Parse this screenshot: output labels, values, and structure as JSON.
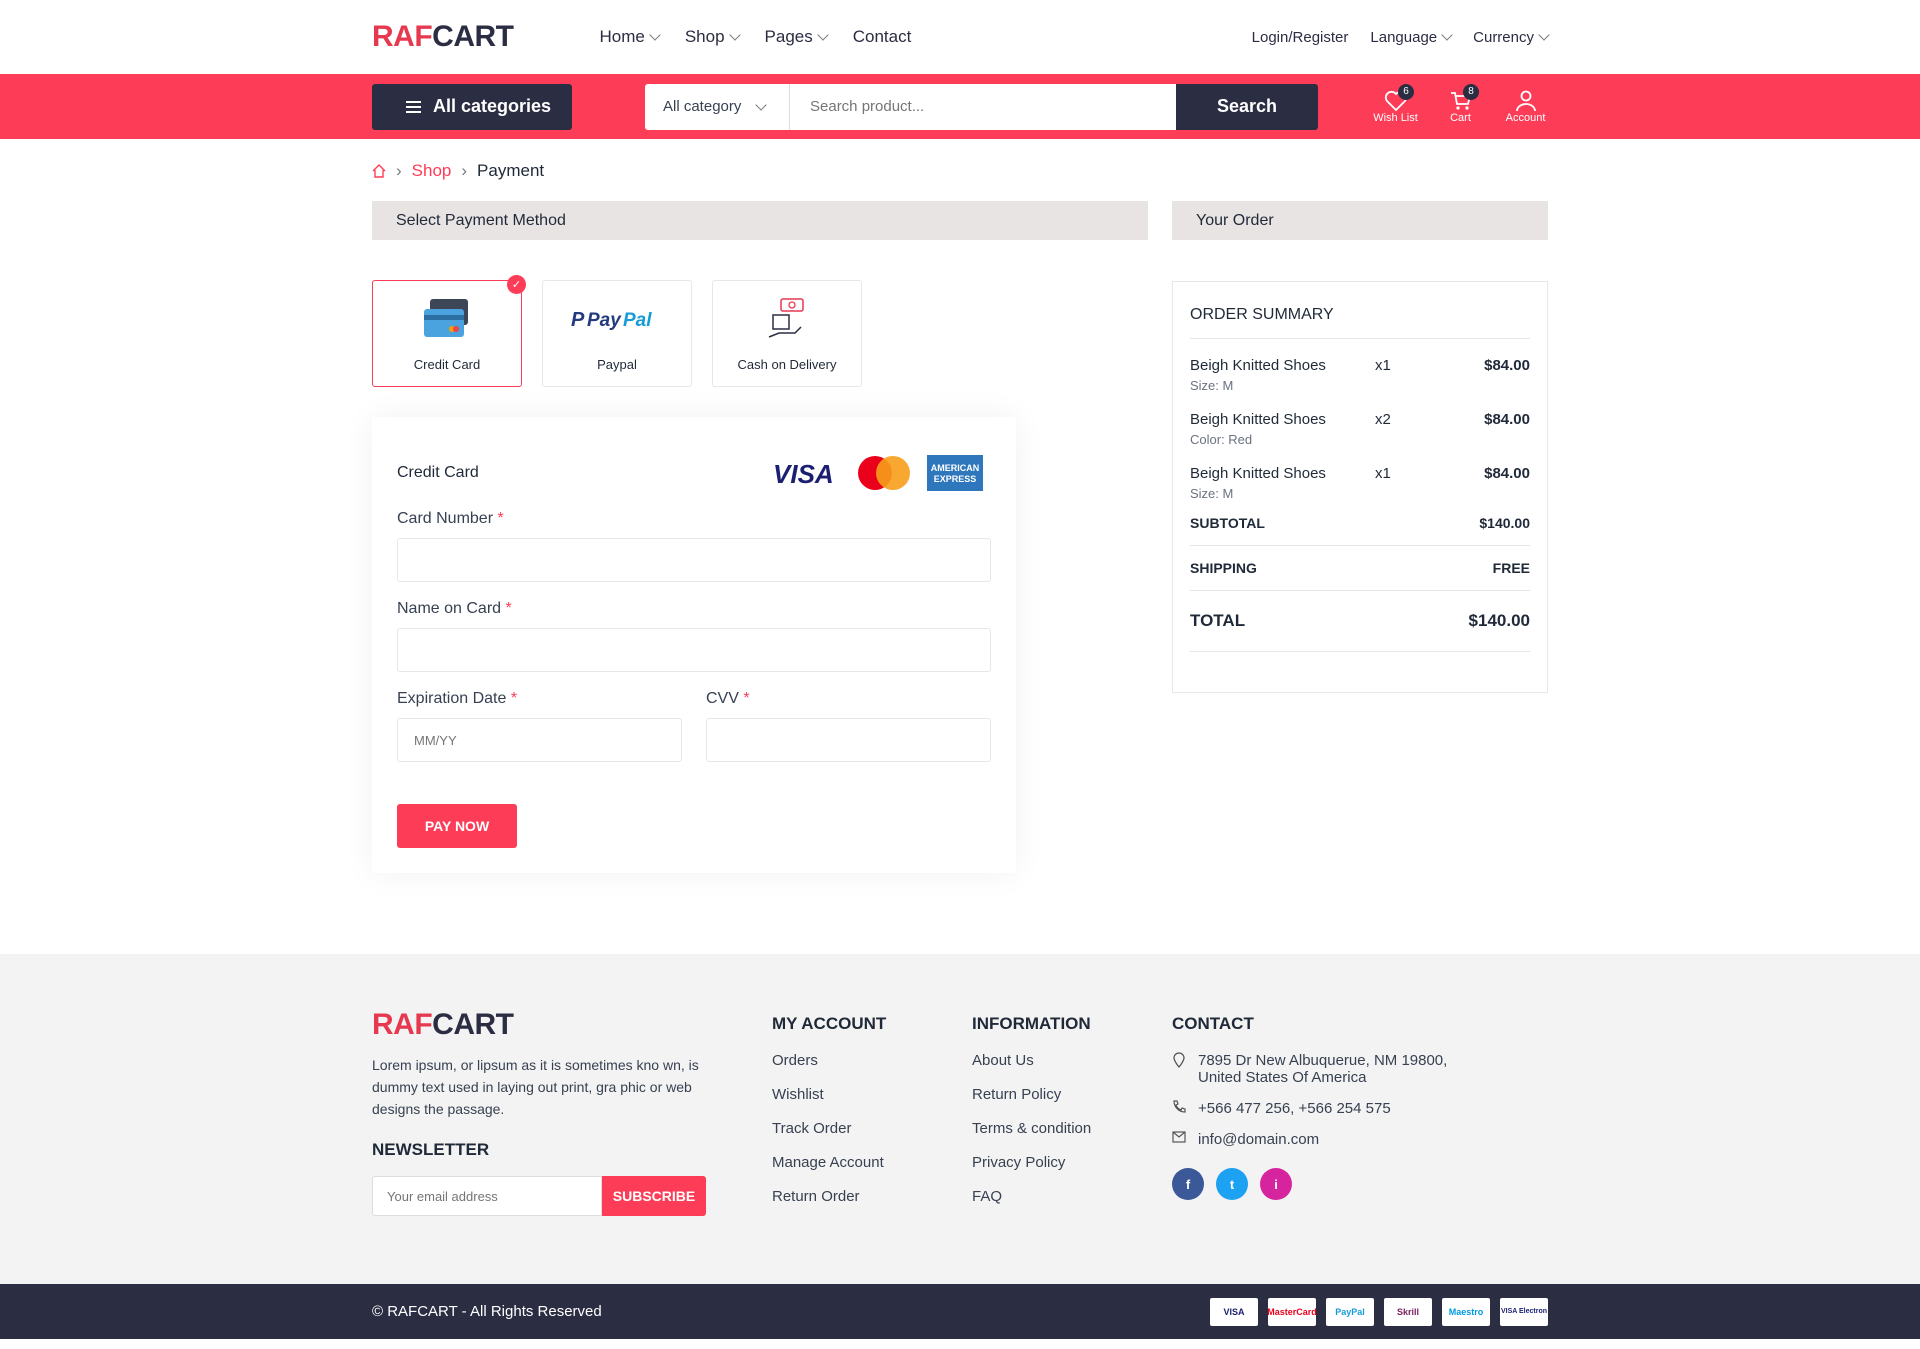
{
  "colors": {
    "accent": "#fd3d57",
    "dark": "#2b2d42",
    "panel": "#e9e4e4"
  },
  "header": {
    "logo_a": "RAF",
    "logo_b": "CART",
    "nav": [
      {
        "label": "Home",
        "has_dropdown": true
      },
      {
        "label": "Shop",
        "has_dropdown": true
      },
      {
        "label": "Pages",
        "has_dropdown": true
      },
      {
        "label": "Contact",
        "has_dropdown": false
      }
    ],
    "right": {
      "login": "Login/Register",
      "language": "Language",
      "currency": "Currency"
    }
  },
  "categorybar": {
    "all_categories": "All categories",
    "category_select": "All category",
    "search_placeholder": "Search product...",
    "search_button": "Search",
    "wishlist": {
      "label": "Wish List",
      "count": "6",
      "icon": "heart-icon"
    },
    "cart": {
      "label": "Cart",
      "count": "8",
      "icon": "cart-icon"
    },
    "account": {
      "label": "Account",
      "icon": "user-icon"
    }
  },
  "breadcrumb": {
    "home_icon": "home-icon",
    "shop": "Shop",
    "current": "Payment"
  },
  "payment": {
    "section_title": "Select Payment Method",
    "methods": [
      {
        "label": "Credit Card",
        "icon": "credit-card-icon",
        "selected": true
      },
      {
        "label": "Paypal",
        "icon": "paypal-icon",
        "selected": false
      },
      {
        "label": "Cash on Delivery",
        "icon": "cash-icon",
        "selected": false
      }
    ],
    "form": {
      "title": "Credit Card",
      "brands": [
        "VISA",
        "Mastercard",
        "American Express"
      ],
      "card_number_label": "Card Number",
      "name_label": "Name on Card",
      "expiry_label": "Expiration Date",
      "expiry_placeholder": "MM/YY",
      "cvv_label": "CVV",
      "required_mark": "*",
      "pay_button": "PAY NOW"
    }
  },
  "order": {
    "section_title": "Your Order",
    "summary_title": "ORDER SUMMARY",
    "items": [
      {
        "name": "Beigh Knitted Shoes",
        "qty": "x1",
        "price": "$84.00",
        "detail": "Size: M"
      },
      {
        "name": "Beigh Knitted Shoes",
        "qty": "x2",
        "price": "$84.00",
        "detail": "Color: Red"
      },
      {
        "name": "Beigh Knitted Shoes",
        "qty": "x1",
        "price": "$84.00",
        "detail": "Size: M"
      }
    ],
    "subtotal_label": "SUBTOTAL",
    "subtotal_value": "$140.00",
    "shipping_label": "SHIPPING",
    "shipping_value": "FREE",
    "total_label": "TOTAL",
    "total_value": "$140.00"
  },
  "footer": {
    "logo_a": "RAF",
    "logo_b": "CART",
    "description": "Lorem ipsum, or lipsum as it is sometimes kno wn, is dummy text used in laying out print, gra phic or web designs the passage.",
    "newsletter_title": "NEWSLETTER",
    "newsletter_placeholder": "Your email address",
    "subscribe": "SUBSCRIBE",
    "my_account_title": "MY ACCOUNT",
    "my_account_links": [
      "Orders",
      "Wishlist",
      "Track Order",
      "Manage Account",
      "Return Order"
    ],
    "information_title": "INFORMATION",
    "information_links": [
      "About Us",
      "Return Policy",
      "Terms & condition",
      "Privacy Policy",
      "FAQ"
    ],
    "contact_title": "CONTACT",
    "address": "7895 Dr New Albuquerue, NM 19800, United States Of America",
    "phone": "+566 477 256, +566 254 575",
    "email": "info@domain.com",
    "social": [
      {
        "icon": "facebook-icon",
        "glyph": "f",
        "color": "#3b5998"
      },
      {
        "icon": "twitter-icon",
        "glyph": "t",
        "color": "#1da1f2"
      },
      {
        "icon": "instagram-icon",
        "glyph": "i",
        "color": "#d6249f"
      }
    ]
  },
  "bottombar": {
    "copyright": "© RAFCART - All Rights Reserved",
    "payment_logos": [
      "VISA",
      "MasterCard",
      "PayPal",
      "Skrill",
      "Maestro",
      "VISA Electron"
    ]
  }
}
